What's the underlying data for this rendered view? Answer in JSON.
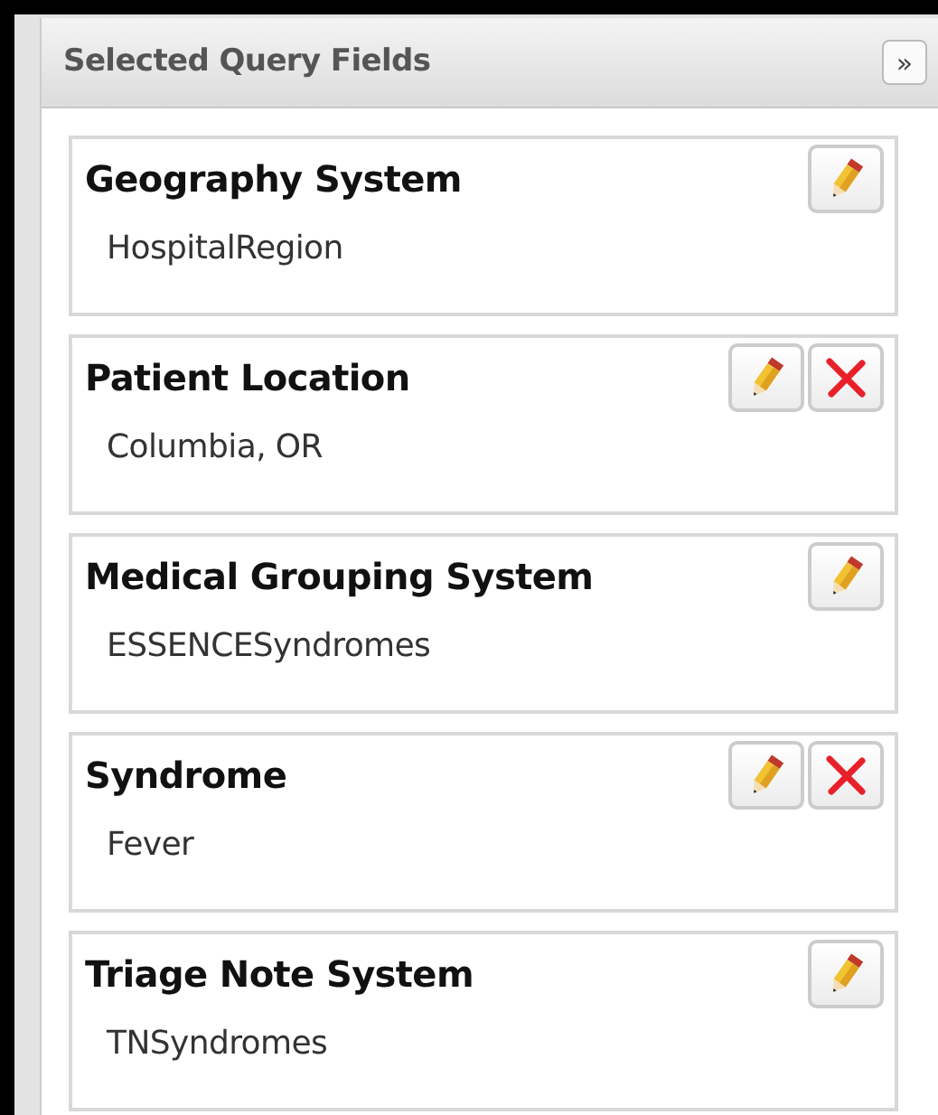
{
  "panel": {
    "title": "Selected Query Fields",
    "collapse_button": "»"
  },
  "fields": [
    {
      "title": "Geography System",
      "value": "HospitalRegion",
      "removable": false
    },
    {
      "title": "Patient Location",
      "value": "Columbia, OR",
      "removable": true
    },
    {
      "title": "Medical Grouping System",
      "value": "ESSENCESyndromes",
      "removable": false
    },
    {
      "title": "Syndrome",
      "value": "Fever",
      "removable": true
    },
    {
      "title": "Triage Note System",
      "value": "TNSyndromes",
      "removable": false
    }
  ]
}
